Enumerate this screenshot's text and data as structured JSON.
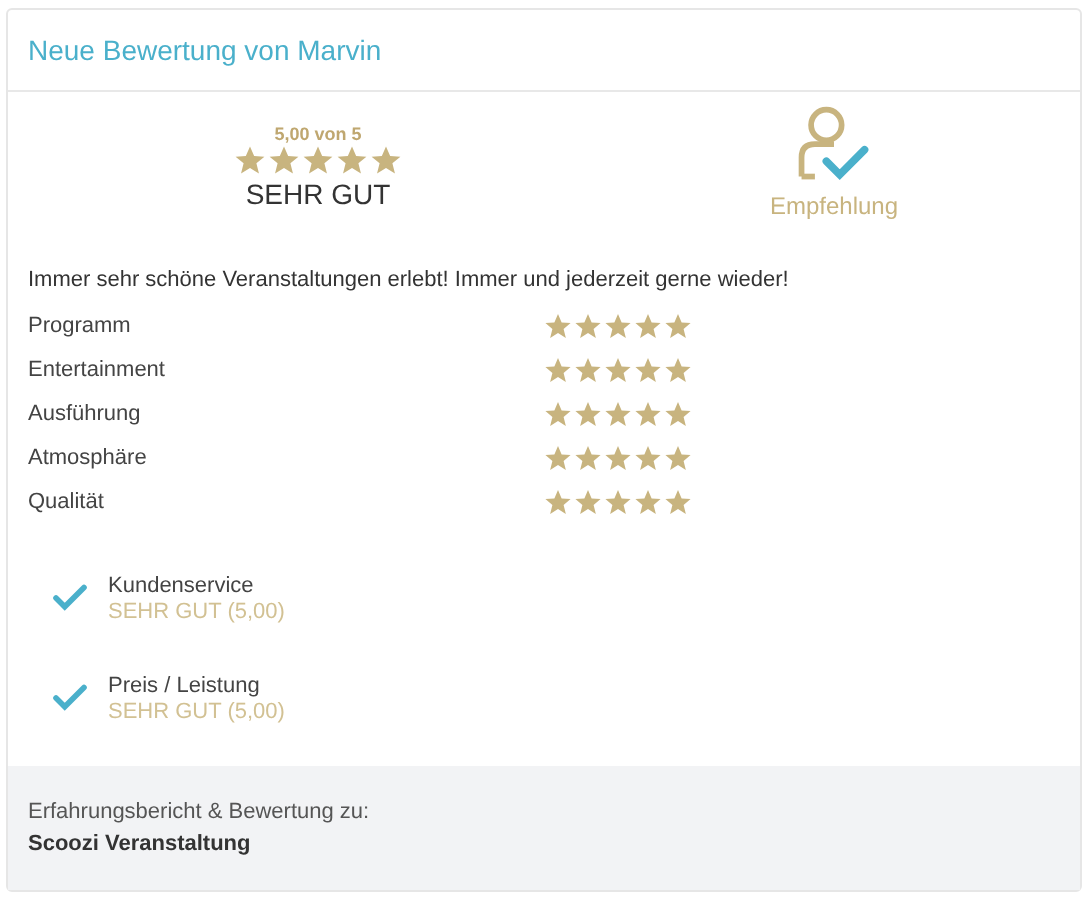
{
  "header": {
    "title": "Neue Bewertung von Marvin"
  },
  "summary": {
    "score": "5,00 von 5",
    "stars": 5,
    "verdict": "SEHR GUT",
    "recommendation": "Empfehlung"
  },
  "comment": "Immer sehr schöne Veranstaltungen erlebt! Immer und jederzeit gerne wieder!",
  "criteria": [
    {
      "label": "Programm",
      "stars": 5
    },
    {
      "label": "Entertainment",
      "stars": 5
    },
    {
      "label": "Ausführung",
      "stars": 5
    },
    {
      "label": "Atmosphäre",
      "stars": 5
    },
    {
      "label": "Qualität",
      "stars": 5
    }
  ],
  "highlights": [
    {
      "label": "Kundenservice",
      "rating": "SEHR GUT (5,00)",
      "checked": true
    },
    {
      "label": "Preis / Leistung",
      "rating": "SEHR GUT (5,00)",
      "checked": true
    }
  ],
  "footer": {
    "caption": "Erfahrungsbericht & Bewertung zu:",
    "subject": "Scoozi Veranstaltung"
  }
}
